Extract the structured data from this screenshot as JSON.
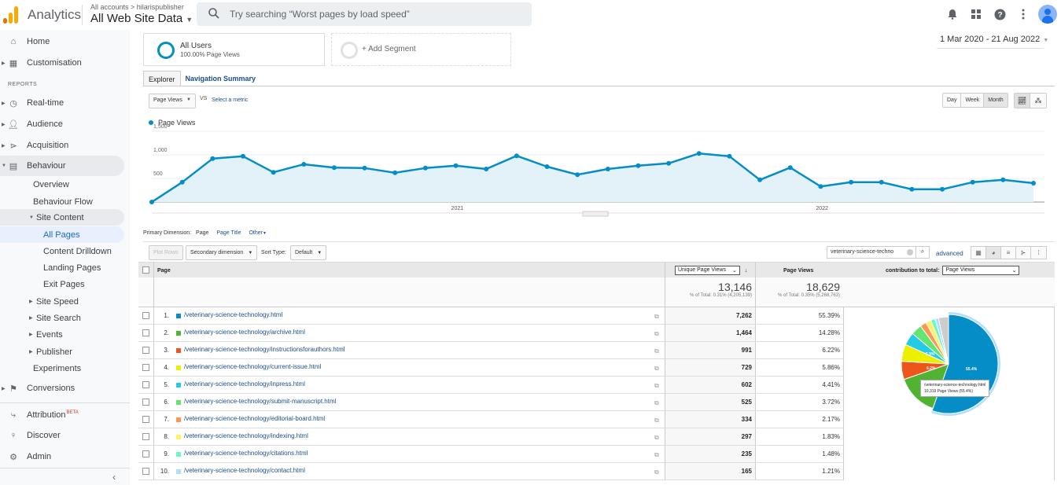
{
  "header": {
    "app_name": "Analytics",
    "account_breadcrumb": "All accounts > hilarispublisher",
    "view_name": "All Web Site Data",
    "search_placeholder": "Try searching “Worst pages by load speed”",
    "icons": [
      "bell-icon",
      "apps-grid-icon",
      "help-icon",
      "more-vert-icon",
      "account-avatar"
    ]
  },
  "sidebar": {
    "reports_label": "REPORTS",
    "items": [
      {
        "label": "Home",
        "icon": "home-icon"
      },
      {
        "label": "Customisation",
        "icon": "dashboard-icon"
      },
      {
        "label": "Real-time",
        "icon": "clock-icon"
      },
      {
        "label": "Audience",
        "icon": "person-icon"
      },
      {
        "label": "Acquisition",
        "icon": "acquisition-icon"
      },
      {
        "label": "Behaviour",
        "icon": "behaviour-icon"
      },
      {
        "label": "Conversions",
        "icon": "flag-icon"
      },
      {
        "label": "Attribution",
        "icon": "attribution-icon",
        "badge": "BETA"
      },
      {
        "label": "Discover",
        "icon": "lightbulb-icon"
      },
      {
        "label": "Admin",
        "icon": "gear-icon"
      }
    ],
    "behaviour_sub": [
      "Overview",
      "Behaviour Flow",
      "Site Content"
    ],
    "site_content_sub": [
      "All Pages",
      "Content Drilldown",
      "Landing Pages",
      "Exit Pages"
    ],
    "behaviour_more": [
      "Site Speed",
      "Site Search",
      "Events",
      "Publisher",
      "Experiments"
    ]
  },
  "segments": {
    "active": {
      "title": "All Users",
      "subtitle": "100.00% Page Views"
    },
    "add_label": "+ Add Segment"
  },
  "date_range": "1 Mar 2020 - 21 Aug 2022",
  "tabs": [
    "Explorer",
    "Navigation Summary"
  ],
  "chart_controls": {
    "metric": "Page Views",
    "vs": "VS",
    "select_metric": "Select a metric",
    "granularity": [
      "Day",
      "Week",
      "Month"
    ],
    "selected_granularity": "Month"
  },
  "chart_data": {
    "type": "line",
    "title": "",
    "series": [
      {
        "name": "Page Views",
        "color": "#058dc7",
        "values": [
          0,
          420,
          920,
          970,
          630,
          800,
          730,
          720,
          620,
          720,
          770,
          700,
          980,
          750,
          580,
          700,
          770,
          820,
          1030,
          970,
          470,
          730,
          330,
          420,
          420,
          270,
          270,
          420,
          470,
          400
        ]
      }
    ],
    "x": [
      "Mar 2020",
      "Apr 2020",
      "May 2020",
      "Jun 2020",
      "Jul 2020",
      "Aug 2020",
      "Sep 2020",
      "Oct 2020",
      "Nov 2020",
      "Dec 2020",
      "Jan 2021",
      "Feb 2021",
      "Mar 2021",
      "Apr 2021",
      "May 2021",
      "Jun 2021",
      "Jul 2021",
      "Aug 2021",
      "Sep 2021",
      "Oct 2021",
      "Nov 2021",
      "Dec 2021",
      "Jan 2022",
      "Feb 2022",
      "Mar 2022",
      "Apr 2022",
      "May 2022",
      "Jun 2022",
      "Jul 2022",
      "Aug 2022"
    ],
    "x_tick_labels": [
      {
        "label": "2021",
        "index": 10
      },
      {
        "label": "2022",
        "index": 22
      }
    ],
    "y_ticks": [
      "500",
      "1,000",
      "1,500"
    ],
    "ylim": [
      0,
      1500
    ],
    "xlabel": "",
    "ylabel": "",
    "grid": true,
    "legend": "top-left"
  },
  "dimension": {
    "label": "Primary Dimension:",
    "current": "Page",
    "options": [
      "Page Title",
      "Other"
    ]
  },
  "table_toolbar": {
    "plot_rows": "Plot Rows",
    "secondary_dimension": "Secondary dimension",
    "sort_type_label": "Sort Type:",
    "sort_type": "Default",
    "filter_value": "veterinary-science-techno",
    "advanced": "advanced"
  },
  "table": {
    "columns": {
      "page": "Page",
      "unique_page_views": "Unique Page Views",
      "page_views": "Page Views",
      "contribution_label": "contribution to total:",
      "contribution_metric": "Page Views"
    },
    "totals": {
      "unique_page_views": "13,146",
      "unique_page_views_pct": "% of Total: 0.31% (4,205,139)",
      "page_views": "18,629",
      "page_views_pct": "% of Total: 0.35% (5,268,763)"
    },
    "rows": [
      {
        "rank": "1.",
        "page": "/veterinary-science-technology.html",
        "color": "#058dc7",
        "unique_page_views": "7,262",
        "contribution": "55.39%",
        "share": 55.39
      },
      {
        "rank": "2.",
        "page": "/veterinary-science-technology/archive.html",
        "color": "#50b432",
        "unique_page_views": "1,464",
        "contribution": "14.28%",
        "share": 14.28
      },
      {
        "rank": "3.",
        "page": "/veterinary-science-technology/instructionsforauthors.html",
        "color": "#ed561b",
        "unique_page_views": "991",
        "contribution": "6.22%",
        "share": 6.22
      },
      {
        "rank": "4.",
        "page": "/veterinary-science-technology/current-issue.html",
        "color": "#edef00",
        "unique_page_views": "729",
        "contribution": "5.86%",
        "share": 5.86
      },
      {
        "rank": "5.",
        "page": "/veterinary-science-technology/inpress.html",
        "color": "#24cbe5",
        "unique_page_views": "602",
        "contribution": "4.41%",
        "share": 4.41
      },
      {
        "rank": "6.",
        "page": "/veterinary-science-technology/submit-manuscript.html",
        "color": "#64e572",
        "unique_page_views": "525",
        "contribution": "3.72%",
        "share": 3.72
      },
      {
        "rank": "7.",
        "page": "/veterinary-science-technology/editorial-board.html",
        "color": "#ff9655",
        "unique_page_views": "334",
        "contribution": "2.17%",
        "share": 2.17
      },
      {
        "rank": "8.",
        "page": "/veterinary-science-technology/indexing.html",
        "color": "#fff263",
        "unique_page_views": "297",
        "contribution": "1.83%",
        "share": 1.83
      },
      {
        "rank": "9.",
        "page": "/veterinary-science-technology/citations.html",
        "color": "#6af9c4",
        "unique_page_views": "235",
        "contribution": "1.48%",
        "share": 1.48
      },
      {
        "rank": "10.",
        "page": "/veterinary-science-technology/contact.html",
        "color": "#b2deff",
        "unique_page_views": "165",
        "contribution": "1.21%",
        "share": 1.21
      }
    ],
    "other_share_color": "#cccccc",
    "pie_labels": [
      "55.4%",
      "6.2%",
      "5.9%"
    ],
    "pie_tooltip": {
      "line1": "/veterinary-science-technology.html",
      "line2": "10,319 Page Views (55.4%)"
    }
  }
}
